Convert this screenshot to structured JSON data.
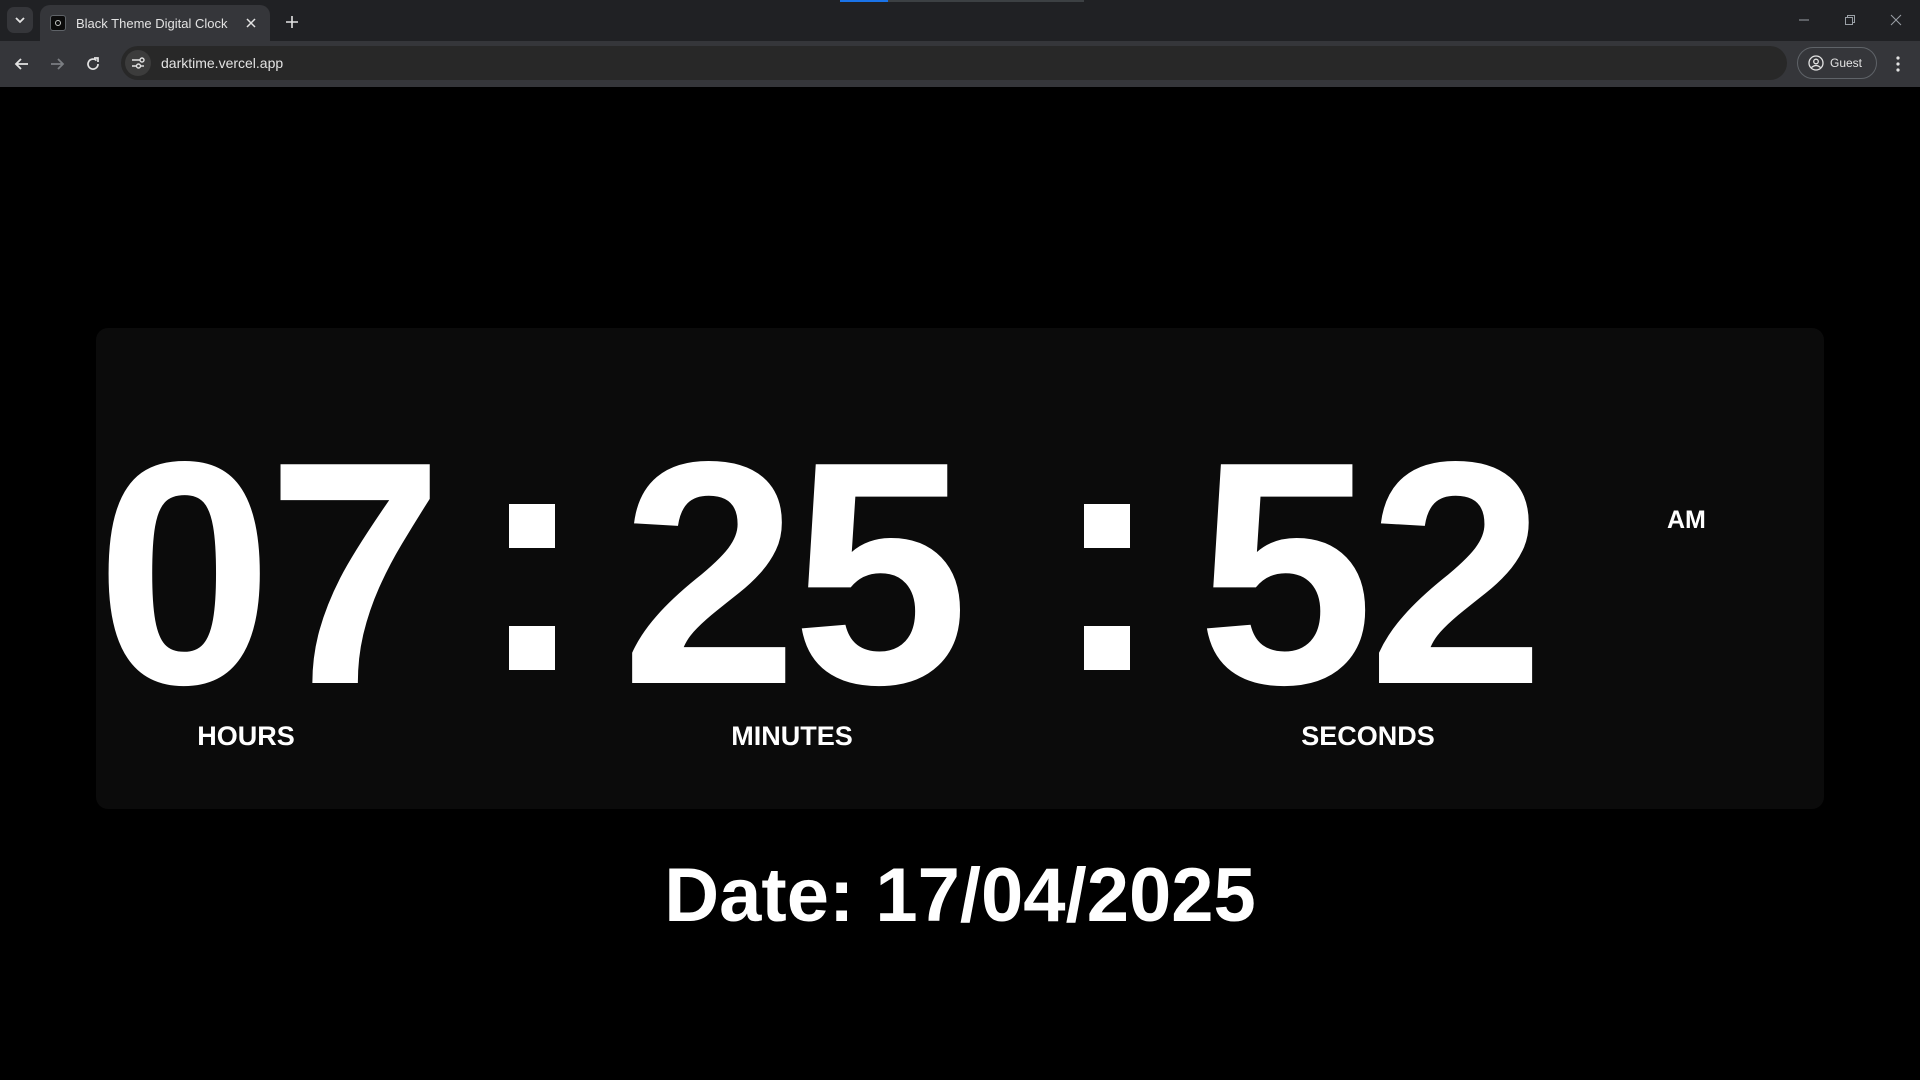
{
  "browser": {
    "tab_title": "Black Theme Digital Clock",
    "url": "darktime.vercel.app",
    "profile_label": "Guest"
  },
  "clock": {
    "hours": "07",
    "minutes": "25",
    "seconds": "52",
    "separator": ":",
    "period": "AM",
    "labels": {
      "hours": "HOURS",
      "minutes": "MINUTES",
      "seconds": "SECONDS"
    }
  },
  "date_text": "Date: 17/04/2025",
  "colors": {
    "page_background": "#000000",
    "card_background": "#0b0b0b",
    "text": "#ffffff",
    "chrome_dark": "#202124",
    "chrome_toolbar": "#35363a"
  }
}
